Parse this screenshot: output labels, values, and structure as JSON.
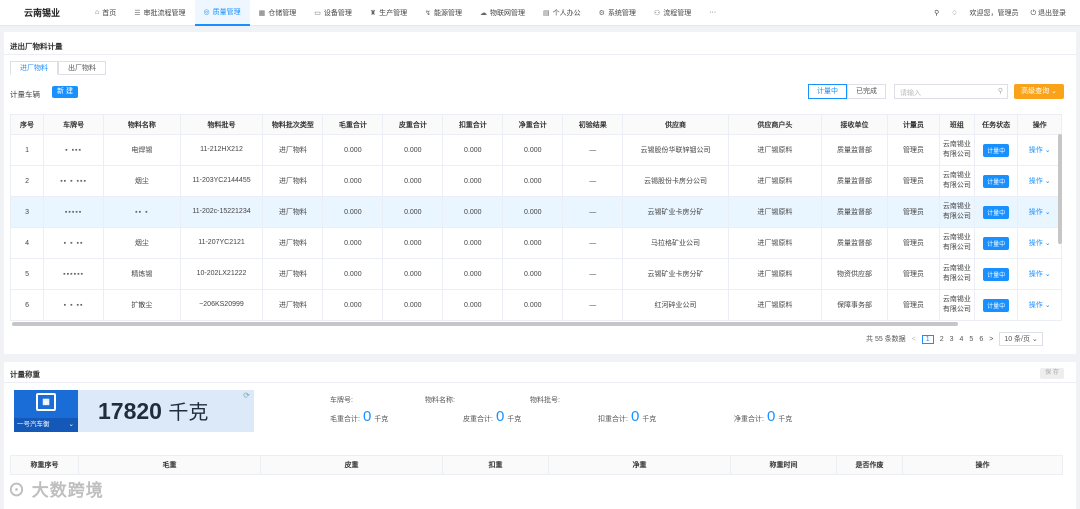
{
  "app": {
    "title": "云南锡业"
  },
  "nav": [
    {
      "label": "首页",
      "icon": "home-icon",
      "glyph": "⌂"
    },
    {
      "label": "审批流程管理",
      "icon": "list-icon",
      "glyph": "☰"
    },
    {
      "label": "质量管理",
      "icon": "quality-icon",
      "glyph": "◎",
      "active": true
    },
    {
      "label": "仓储管理",
      "icon": "warehouse-icon",
      "glyph": "▦"
    },
    {
      "label": "设备管理",
      "icon": "monitor-icon",
      "glyph": "▭"
    },
    {
      "label": "生产管理",
      "icon": "factory-icon",
      "glyph": "♜"
    },
    {
      "label": "能源管理",
      "icon": "energy-icon",
      "glyph": "↯"
    },
    {
      "label": "物联网管理",
      "icon": "cloud-icon",
      "glyph": "☁"
    },
    {
      "label": "个人办公",
      "icon": "calendar-icon",
      "glyph": "▤"
    },
    {
      "label": "系统管理",
      "icon": "gear-icon",
      "glyph": "⚙"
    },
    {
      "label": "流程管理",
      "icon": "flow-icon",
      "glyph": "⚇"
    },
    {
      "label": "···",
      "icon": "more-icon",
      "glyph": ""
    }
  ],
  "topright": {
    "welcome": "欢迎您，管理员",
    "logout": "退出登录"
  },
  "page_title": "进出厂物料计量",
  "tabs": {
    "in": "进厂物料",
    "out": "出厂物料"
  },
  "toolbar": {
    "label": "计量车辆",
    "new_btn": "新 建",
    "seg_active": "计量中",
    "seg_done": "已完成",
    "search_placeholder": "请输入",
    "adv": "高级查询 ⌄"
  },
  "columns": [
    "序号",
    "车牌号",
    "物料名称",
    "物料批号",
    "物料批次类型",
    "毛重合计",
    "皮重合计",
    "扣重合计",
    "净重合计",
    "初验结果",
    "供应商",
    "供应商户头",
    "接收单位",
    "计量员",
    "班组",
    "任务状态",
    "操作"
  ],
  "rows": [
    {
      "no": "1",
      "plate": "▪ ▪▪▪",
      "name": "电焊锡",
      "batch": "11-212HX212",
      "type": "进厂物料",
      "gross": "0.000",
      "tare": "0.000",
      "deduct": "0.000",
      "net": "0.000",
      "check": "—",
      "supplier": "云锡股份华联锌铟公司",
      "account": "进厂锡原料",
      "unit": "质量监督部",
      "operator": "管理员",
      "team": "云南锡业有限公司",
      "status": "计量中",
      "op": "操作 ⌄"
    },
    {
      "no": "2",
      "plate": "▪▪ ▪ ▪▪▪",
      "name": "烟尘",
      "batch": "11-203YC2144455",
      "type": "进厂物料",
      "gross": "0.000",
      "tare": "0.000",
      "deduct": "0.000",
      "net": "0.000",
      "check": "—",
      "supplier": "云锡股份卡房分公司",
      "account": "进厂锡原料",
      "unit": "质量监督部",
      "operator": "管理员",
      "team": "云南锡业有限公司",
      "status": "计量中",
      "op": "操作 ⌄"
    },
    {
      "no": "3",
      "plate": "▪▪▪▪▪",
      "name": "▪▪  ▪",
      "batch": "11-202c-15221234",
      "type": "进厂物料",
      "gross": "0.000",
      "tare": "0.000",
      "deduct": "0.000",
      "net": "0.000",
      "check": "—",
      "supplier": "云锡矿业卡房分矿",
      "account": "进厂锡原料",
      "unit": "质量监督部",
      "operator": "管理员",
      "team": "云南锡业有限公司",
      "status": "计量中",
      "op": "操作 ⌄"
    },
    {
      "no": "4",
      "plate": "▪ ▪ ▪▪",
      "name": "烟尘",
      "batch": "11-207YC2121",
      "type": "进厂物料",
      "gross": "0.000",
      "tare": "0.000",
      "deduct": "0.000",
      "net": "0.000",
      "check": "—",
      "supplier": "马拉格矿业公司",
      "account": "进厂锡原料",
      "unit": "质量监督部",
      "operator": "管理员",
      "team": "云南锡业有限公司",
      "status": "计量中",
      "op": "操作 ⌄"
    },
    {
      "no": "5",
      "plate": "▪▪▪▪▪▪",
      "name": "精炼锡",
      "batch": "10-202LX21222",
      "type": "进厂物料",
      "gross": "0.000",
      "tare": "0.000",
      "deduct": "0.000",
      "net": "0.000",
      "check": "—",
      "supplier": "云锡矿业卡房分矿",
      "account": "进厂锡原料",
      "unit": "物资供应部",
      "operator": "管理员",
      "team": "云南锡业有限公司",
      "status": "计量中",
      "op": "操作 ⌄"
    },
    {
      "no": "6",
      "plate": "▪ ▪ ▪▪",
      "name": "扩散尘",
      "batch": "~206KS20999",
      "type": "进厂物料",
      "gross": "0.000",
      "tare": "0.000",
      "deduct": "0.000",
      "net": "0.000",
      "check": "—",
      "supplier": "红河碎业公司",
      "account": "进厂锡原料",
      "unit": "保障事务部",
      "operator": "管理员",
      "team": "云南锡业有限公司",
      "status": "计量中",
      "op": "操作 ⌄"
    }
  ],
  "selected_row": 2,
  "pager": {
    "total": "共 55 条数据",
    "pages": [
      "1",
      "2",
      "3",
      "4",
      "5",
      "6"
    ],
    "current": "1",
    "size": "10 条/页 ⌄"
  },
  "weigh": {
    "title": "计量称重",
    "save": "保 存",
    "weight": "17820",
    "unit": "千克",
    "truck": "一号汽车衡",
    "plate_lbl": "车牌号:",
    "name_lbl": "物料名称:",
    "batch_lbl": "物料批号:",
    "gross_lbl": "毛重合计:",
    "tare_lbl": "皮重合计:",
    "deduct_lbl": "扣重合计:",
    "net_lbl": "净重合计:",
    "zero": "0",
    "kg": "千克"
  },
  "bottom_cols": [
    "称重序号",
    "毛重",
    "皮重",
    "扣重",
    "净重",
    "称重时间",
    "是否作废",
    "操作"
  ],
  "watermark": "大数跨境"
}
